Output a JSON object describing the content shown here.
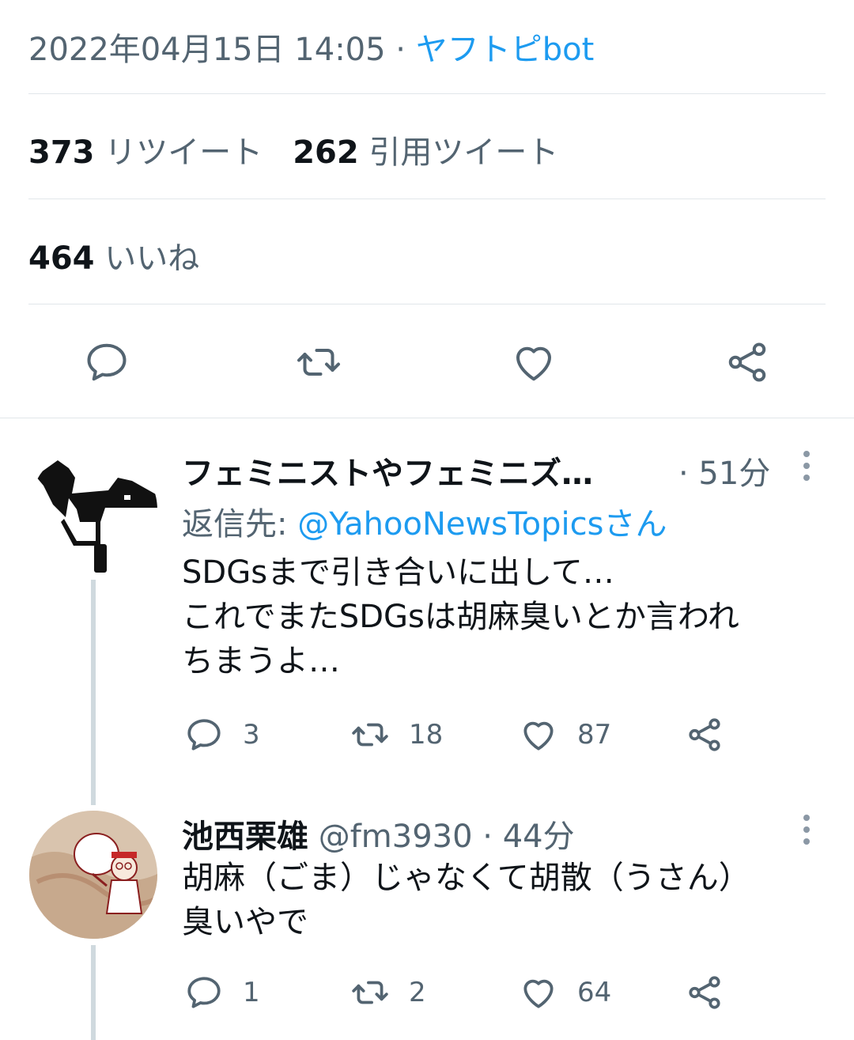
{
  "tweet": {
    "timestamp": "2022年04月15日 14:05",
    "separator": " · ",
    "via": "ヤフトピbot",
    "retweet_count": "373",
    "retweet_label": "リツイート",
    "quote_count": "262",
    "quote_label": "引用ツイート",
    "like_count": "464",
    "like_label": "いいね"
  },
  "icons": {
    "reply": "speech-bubble-icon",
    "retweet": "retweet-arrows-icon",
    "like": "heart-icon",
    "share": "share-nodes-icon"
  },
  "replies": [
    {
      "name": "フェミニストやフェミニズ…",
      "handle": "",
      "time": "· 51分",
      "reply_to_prefix": "返信先: ",
      "reply_to_handle": "@YahooNewsTopicsさん",
      "text": "SDGsまで引き合いに出して…\nこれでまたSDGsは胡麻臭いとか言われ\nちまうよ…",
      "reply_count": "3",
      "retweet_count": "18",
      "like_count": "87"
    },
    {
      "name": "池西栗雄",
      "handle": "@fm3930",
      "time": " · 44分",
      "text": "胡麻（ごま）じゃなくて胡散（うさん）\n臭いやで",
      "reply_count": "1",
      "retweet_count": "2",
      "like_count": "64"
    }
  ],
  "colors": {
    "accent": "#1d9bf0",
    "text": "#0f1419",
    "muted": "#536471",
    "divider": "#e1e6ea"
  }
}
